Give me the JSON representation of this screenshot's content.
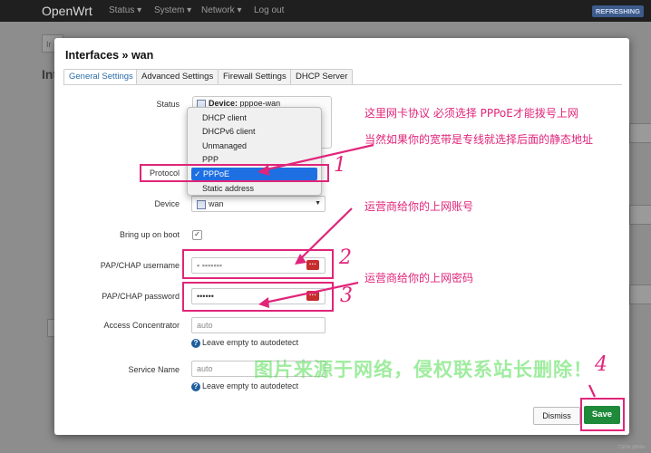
{
  "topbar": {
    "brand": "OpenWrt",
    "nav": [
      "Status ▾",
      "System ▾",
      "Network ▾",
      "Log out"
    ],
    "refresh": "REFRESHING"
  },
  "background": {
    "tab_label": "Ir",
    "title": "Int"
  },
  "modal": {
    "title": "Interfaces » wan",
    "tabs": [
      "General Settings",
      "Advanced Settings",
      "Firewall Settings",
      "DHCP Server"
    ],
    "active_tab": "General Settings"
  },
  "status": {
    "label": "Status",
    "device_prefix": "Device:",
    "device": "pppoe-wan"
  },
  "protocol": {
    "label": "Protocol",
    "options": [
      "DHCP client",
      "DHCPv6 client",
      "Unmanaged",
      "PPP",
      "PPPoE",
      "Static address"
    ],
    "selected": "PPPoE"
  },
  "device": {
    "label": "Device",
    "value": "wan"
  },
  "bring_up": {
    "label": "Bring up on boot",
    "checked": true,
    "mark": "✓"
  },
  "username": {
    "label": "PAP/CHAP username",
    "value": "▪ ▪▪▪▪▪▪▪"
  },
  "password": {
    "label": "PAP/CHAP password",
    "value": "••••••"
  },
  "access_concentrator": {
    "label": "Access Concentrator",
    "placeholder": "auto",
    "hint": "Leave empty to autodetect"
  },
  "service_name": {
    "label": "Service Name",
    "placeholder": "auto",
    "hint": "Leave empty to autodetect"
  },
  "buttons": {
    "dismiss": "Dismiss",
    "save": "Save"
  },
  "annotations": {
    "note1": "这里网卡协议 必须选择 PPPoE才能拨号上网",
    "note2": "当然如果你的宽带是专线就选择后面的静态地址",
    "note3": "运营商给你的上网账号",
    "note4": "运营商给你的上网密码",
    "num1": "1",
    "num2": "2",
    "num3": "3",
    "num4": "4",
    "watermark": "图片来源于网络，侵权联系站长删除！",
    "credit": "CSDN @lhilin",
    "color": "#e0257a"
  },
  "colors": {
    "accent": "#2b6ca8",
    "save": "#1e8a3a",
    "selection": "#1d6fe2",
    "pwd_button": "#c62d2d"
  }
}
